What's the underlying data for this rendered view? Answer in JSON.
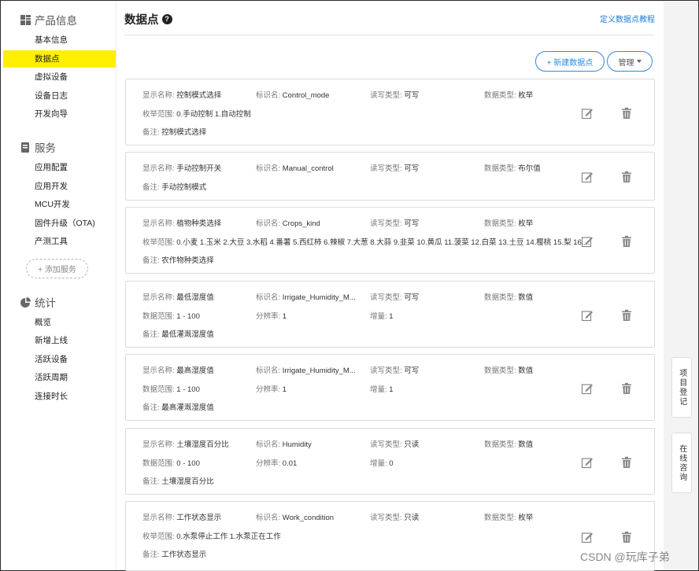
{
  "sidebar": {
    "section1": {
      "title": "产品信息",
      "icon": "grid-icon",
      "items": [
        "基本信息",
        "数据点",
        "虚拟设备",
        "设备日志",
        "开发向导"
      ]
    },
    "section2": {
      "title": "服务",
      "icon": "book-icon",
      "items": [
        "应用配置",
        "应用开发",
        "MCU开发",
        "固件升级（OTA)",
        "产测工具"
      ],
      "add_label": "+ 添加服务"
    },
    "section3": {
      "title": "统计",
      "icon": "pie-icon",
      "items": [
        "概览",
        "新增上线",
        "活跃设备",
        "活跃周期",
        "连接时长"
      ]
    },
    "active_item": "数据点",
    "active_color": "#ffef00"
  },
  "header": {
    "title": "数据点",
    "help_icon": "?",
    "tutorial_link": "定义数据点教程",
    "new_button": "+ 新建数据点",
    "manage_button": "管理"
  },
  "labels": {
    "display_name": "显示名称:",
    "identifier": "标识名:",
    "rw_type": "读写类型:",
    "data_type": "数据类型:",
    "enum_range": "枚举范围:",
    "data_range": "数据范围:",
    "resolution": "分辨率:",
    "increment": "增量:",
    "remark": "备注:"
  },
  "datapoints": [
    {
      "name": "控制模式选择",
      "id": "Control_mode",
      "rw": "可写",
      "type": "枚举",
      "range_label": "枚举范围:",
      "range": "0.手动控制 1.自动控制",
      "remark": "控制模式选择"
    },
    {
      "name": "手动控制开关",
      "id": "Manual_control",
      "rw": "可写",
      "type": "布尔值",
      "remark": "手动控制模式"
    },
    {
      "name": "植物种类选择",
      "id": "Crops_kind",
      "rw": "可写",
      "type": "枚举",
      "range_label": "枚举范围:",
      "range": "0.小麦 1.玉米 2.大豆 3.水稻 4.番薯 5.西红柿 6.辣椒 7.大葱 8.大蒜 9.韭菜 10.黄瓜 11.菠菜 12.白菜 13.土豆 14.樱桃 15.梨 16....",
      "remark": "农作物种类选择"
    },
    {
      "name": "最低湿度值",
      "id": "Irrigate_Humidity_M...",
      "rw": "可写",
      "type": "数值",
      "range_label": "数据范围:",
      "range": "1 - 100",
      "resolution": "1",
      "increment": "1",
      "remark": "最低灌溉湿度值"
    },
    {
      "name": "最高湿度值",
      "id": "Irrigate_Humidity_M...",
      "rw": "可写",
      "type": "数值",
      "range_label": "数据范围:",
      "range": "1 - 100",
      "resolution": "1",
      "increment": "1",
      "remark": "最高灌溉湿度值"
    },
    {
      "name": "土壤湿度百分比",
      "id": "Humidity",
      "rw": "只读",
      "type": "数值",
      "range_label": "数据范围:",
      "range": "0 - 100",
      "resolution": "0.01",
      "increment": "0",
      "remark": "土壤湿度百分比"
    },
    {
      "name": "工作状态显示",
      "id": "Work_condition",
      "rw": "只读",
      "type": "枚举",
      "range_label": "枚举范围:",
      "range": "0.水泵停止工作 1.水泵正在工作",
      "remark": "工作状态显示"
    }
  ],
  "float_tabs": {
    "register": "项目登记",
    "consult": "在线咨询"
  },
  "watermark": "CSDN @玩库子弟",
  "colors": {
    "link": "#1e7ad4",
    "button_border": "#2e8ae6"
  }
}
